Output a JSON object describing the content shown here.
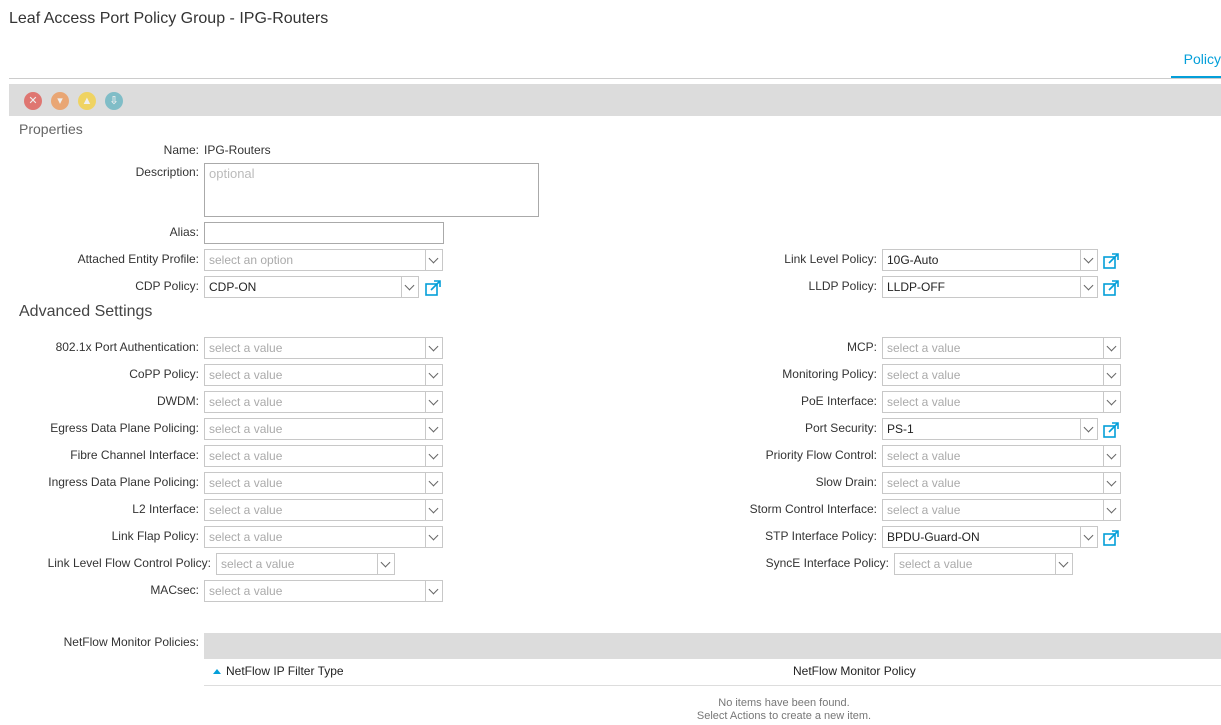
{
  "header": {
    "title": "Leaf Access Port Policy Group - IPG-Routers",
    "tab_policy": "Policy"
  },
  "toolbar": {
    "faults": [
      "critical-fault-icon",
      "major-fault-icon",
      "minor-fault-icon",
      "warning-fault-icon"
    ],
    "fault_colors": [
      "#e2231a",
      "#f47b20",
      "#ffcc00",
      "#36a5b7"
    ]
  },
  "properties": {
    "section_title": "Properties",
    "name_label": "Name:",
    "name_value": "IPG-Routers",
    "description_label": "Description:",
    "description_placeholder": "optional",
    "alias_label": "Alias:",
    "alias_value": "",
    "aep_label": "Attached Entity Profile:",
    "aep_placeholder": "select an option",
    "cdp_label": "CDP Policy:",
    "cdp_value": "CDP-ON",
    "link_level_label": "Link Level Policy:",
    "link_level_value": "10G-Auto",
    "lldp_label": "LLDP Policy:",
    "lldp_value": "LLDP-OFF"
  },
  "advanced": {
    "section_title": "Advanced Settings",
    "placeholder": "select a value",
    "left": [
      {
        "label": "802.1x Port Authentication:",
        "value": ""
      },
      {
        "label": "CoPP Policy:",
        "value": ""
      },
      {
        "label": "DWDM:",
        "value": ""
      },
      {
        "label": "Egress Data Plane Policing:",
        "value": ""
      },
      {
        "label": "Fibre Channel Interface:",
        "value": ""
      },
      {
        "label": "Ingress Data Plane Policing:",
        "value": ""
      },
      {
        "label": "L2 Interface:",
        "value": ""
      },
      {
        "label": "Link Flap Policy:",
        "value": ""
      },
      {
        "label": "Link Level Flow Control Policy:",
        "value": ""
      },
      {
        "label": "MACsec:",
        "value": ""
      }
    ],
    "right": [
      {
        "label": "MCP:",
        "value": ""
      },
      {
        "label": "Monitoring Policy:",
        "value": ""
      },
      {
        "label": "PoE Interface:",
        "value": ""
      },
      {
        "label": "Port Security:",
        "value": "PS-1"
      },
      {
        "label": "Priority Flow Control:",
        "value": ""
      },
      {
        "label": "Slow Drain:",
        "value": ""
      },
      {
        "label": "Storm Control Interface:",
        "value": ""
      },
      {
        "label": "STP Interface Policy:",
        "value": "BPDU-Guard-ON"
      },
      {
        "label": "SyncE Interface Policy:",
        "value": ""
      }
    ]
  },
  "netflow": {
    "label": "NetFlow Monitor Policies:",
    "col1": "NetFlow IP Filter Type",
    "col2": "NetFlow Monitor Policy",
    "empty_line1": "No items have been found.",
    "empty_line2": "Select Actions to create a new item."
  }
}
